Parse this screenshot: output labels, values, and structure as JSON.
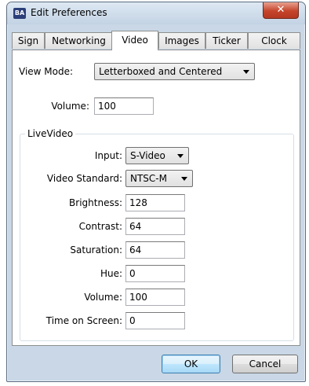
{
  "window": {
    "title": "Edit Preferences",
    "app_icon_text": "BA",
    "close_glyph": "✕"
  },
  "tabs": [
    {
      "label": "Sign",
      "active": false
    },
    {
      "label": "Networking",
      "active": false
    },
    {
      "label": "Video",
      "active": true
    },
    {
      "label": "Images",
      "active": false
    },
    {
      "label": "Ticker",
      "active": false
    },
    {
      "label": "Clock",
      "active": false
    }
  ],
  "video": {
    "view_mode_label": "View Mode:",
    "view_mode_value": "Letterboxed and Centered",
    "volume_label": "Volume:",
    "volume_value": "100"
  },
  "live_video": {
    "group_title": "LiveVideo",
    "input_label": "Input:",
    "input_value": "S-Video",
    "standard_label": "Video Standard:",
    "standard_value": "NTSC-M",
    "brightness_label": "Brightness:",
    "brightness_value": "128",
    "contrast_label": "Contrast:",
    "contrast_value": "64",
    "saturation_label": "Saturation:",
    "saturation_value": "64",
    "hue_label": "Hue:",
    "hue_value": "0",
    "volume_label": "Volume:",
    "volume_value": "100",
    "time_label": "Time on Screen:",
    "time_value": "0"
  },
  "buttons": {
    "ok_label": "OK",
    "cancel_label": "Cancel"
  },
  "colors": {
    "frame": "#c9d7e6",
    "close_button": "#c5452b",
    "default_button": "#bee6fd"
  }
}
